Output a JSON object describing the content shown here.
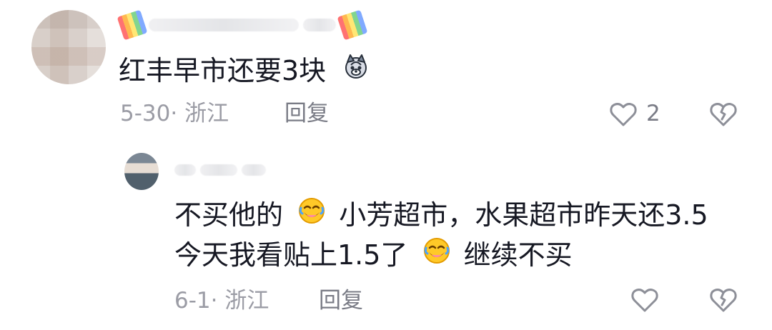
{
  "comment_1": {
    "text_prefix": "红丰早市还要3块",
    "emoji_1": "dog-emoji",
    "meta": "5-30· 浙江",
    "reply_label": "回复",
    "like_count": "2"
  },
  "comment_2": {
    "line1_prefix": "不买他的",
    "line1_middle": "小芳超市，水果超市昨天还3.5",
    "line2_prefix": "今天我看贴上1.5了",
    "line2_suffix": "继续不买",
    "meta": "6-1· 浙江",
    "reply_label": "回复"
  },
  "icons": {
    "heart": "heart-outline-icon",
    "dislike": "broken-heart-icon",
    "laugh": "laugh-cry-emoji"
  }
}
